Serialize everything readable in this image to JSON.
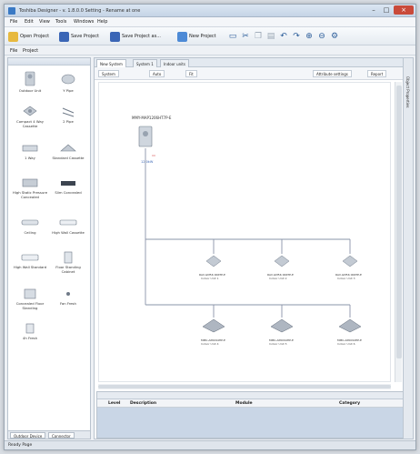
{
  "window": {
    "title": "Toshiba Designer - v. 1.8.0.0 Setting - Rename at one"
  },
  "menu": [
    "File",
    "Edit",
    "View",
    "Tools",
    "Windows",
    "Help"
  ],
  "toolbar": {
    "open_project": "Open Project",
    "save_project": "Save Project",
    "save_project_as": "Save Project as...",
    "new_project": "New Project"
  },
  "subbar": [
    "File",
    "Project"
  ],
  "palette": {
    "items": [
      "Outdoor Unit",
      "Y Pipe",
      "Compact 4 Way Cassette",
      "2 Pipe",
      "1 Way",
      "Standard Cassette",
      "High Static Pressure Concealed",
      "Slim Concealed",
      "Ceiling",
      "High Wall Cassette",
      "High Wall Standard",
      "Floor Standing Cabinet",
      "Concealed Floor Standing",
      "Fan Fresh",
      "4h Fresh"
    ],
    "tabs": [
      "Outdoor Device",
      "Connector"
    ]
  },
  "canvas": {
    "tabs": [
      "New System",
      "System 1",
      "Indoor units"
    ],
    "toolbar": {
      "system": "System",
      "auto": "Auto",
      "fit": "Fit",
      "auto_settings": "Attribute settings",
      "report": "Report"
    },
    "diagram": {
      "outdoor": {
        "name": "MMY-MAP1206HT7P-E",
        "detail1": "12.0kW"
      },
      "indoor_top": [
        {
          "name": "RAV-GM56 0KRTP-E",
          "model": "Indoor Unit 1"
        },
        {
          "name": "RAV-GM56 0KRTP-E",
          "model": "Indoor Unit 2"
        },
        {
          "name": "RAV-GM56 0KRTP-E",
          "model": "Indoor Unit 3"
        }
      ],
      "indoor_bottom": [
        {
          "name": "MMU-AP0094HP-E",
          "model": "Indoor Unit 4"
        },
        {
          "name": "MMU-AP0094HP-E",
          "model": "Indoor Unit 5"
        },
        {
          "name": "MMU-AP0094HP-E",
          "model": "Indoor Unit 6"
        }
      ]
    }
  },
  "bottom_panel": {
    "headers": [
      "Level",
      "Description",
      "Module",
      "Category"
    ]
  },
  "side_strip": {
    "label": "Object Properties"
  },
  "status": {
    "text": "Ready Page"
  },
  "colors": {
    "accent": "#3a79c4",
    "pipe": "#8a94a8",
    "danger": "#d03030"
  }
}
